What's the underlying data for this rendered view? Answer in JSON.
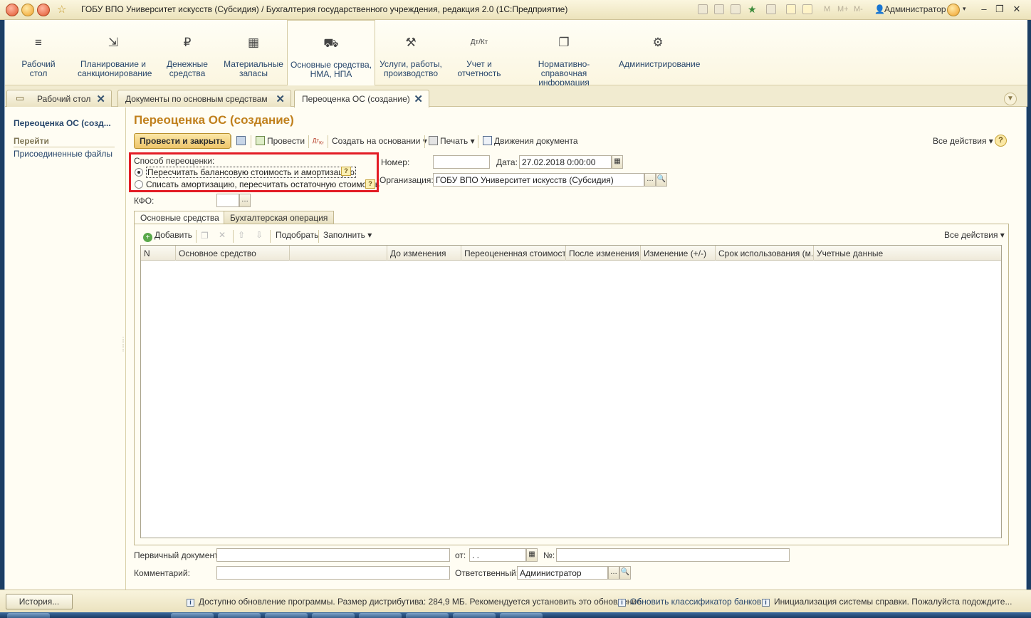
{
  "window": {
    "title": "ГОБУ ВПО Университет искусств (Субсидия) / Бухгалтерия государственного учреждения, редакция 2.0  (1С:Предприятие)",
    "memory_labels": [
      "M",
      "M+",
      "M-"
    ],
    "user": "Администратор"
  },
  "sections": [
    {
      "label": "Рабочий\nстол",
      "icon": "menu-icon"
    },
    {
      "label": "Планирование и\nсанкционирование",
      "icon": "planning-icon"
    },
    {
      "label": "Денежные\nсредства",
      "icon": "ruble-icon"
    },
    {
      "label": "Материальные\nзапасы",
      "icon": "grid-icon"
    },
    {
      "label": "Основные средства,\nНМА, НПА",
      "icon": "truck-icon"
    },
    {
      "label": "Услуги, работы,\nпроизводство",
      "icon": "tools-icon"
    },
    {
      "label": "Учет и\nотчетность",
      "icon": "dtkt-icon"
    },
    {
      "label": "Нормативно-справочная\nинформация",
      "icon": "documents-icon"
    },
    {
      "label": "Администрирование",
      "icon": "gear-icon"
    }
  ],
  "window_tabs": [
    {
      "label": "Рабочий стол"
    },
    {
      "label": "Документы по основным средствам"
    },
    {
      "label": "Переоценка ОС (создание)"
    }
  ],
  "nav": {
    "title": "Переоценка ОС (созд...",
    "goto_label": "Перейти",
    "files_link": "Присоединенные файлы"
  },
  "form": {
    "title": "Переоценка ОС (создание)",
    "toolbar": {
      "post_close": "Провести и закрыть",
      "post": "Провести",
      "create_based": "Создать на основании",
      "print": "Печать",
      "movements": "Движения документа",
      "all_actions": "Все действия"
    },
    "method": {
      "label": "Способ переоценки:",
      "options": [
        "Пересчитать балансовую стоимость и амортизацию",
        "Списать амортизацию, пересчитать остаточную стоимость"
      ],
      "selected_index": 0
    },
    "number_label": "Номер:",
    "number_value": "",
    "date_label": "Дата:",
    "date_value": "27.02.2018  0:00:00",
    "org_label": "Организация:",
    "org_value": "ГОБУ ВПО Университет искусств (Субсидия)",
    "kfo_label": "КФО:",
    "kfo_value": "",
    "inner_tabs": [
      "Основные средства",
      "Бухгалтерская операция"
    ],
    "table_toolbar": {
      "add": "Добавить",
      "pick": "Подобрать",
      "fill": "Заполнить",
      "all_actions": "Все действия"
    },
    "columns": [
      "N",
      "Основное средство",
      "",
      "До изменения",
      "Переоцененная стоимость",
      "После изменения",
      "Изменение (+/-)",
      "Срок использования (м...",
      "Учетные данные"
    ],
    "rows": [],
    "primary_doc_label": "Первичный документ:",
    "primary_doc_value": "",
    "from_label": "от:",
    "from_value": " .  .",
    "num_label": "№:",
    "num_value": "",
    "comment_label": "Комментарий:",
    "comment_value": "",
    "responsible_label": "Ответственный:",
    "responsible_value": "Администратор"
  },
  "status": {
    "history_button": "История...",
    "messages": [
      "Доступно обновление программы. Размер дистрибутива: 284,9 МБ. Рекомендуется установить это обновление.",
      "Обновить классификатор банков",
      "Инициализация системы справки. Пожалуйста подождите..."
    ]
  }
}
